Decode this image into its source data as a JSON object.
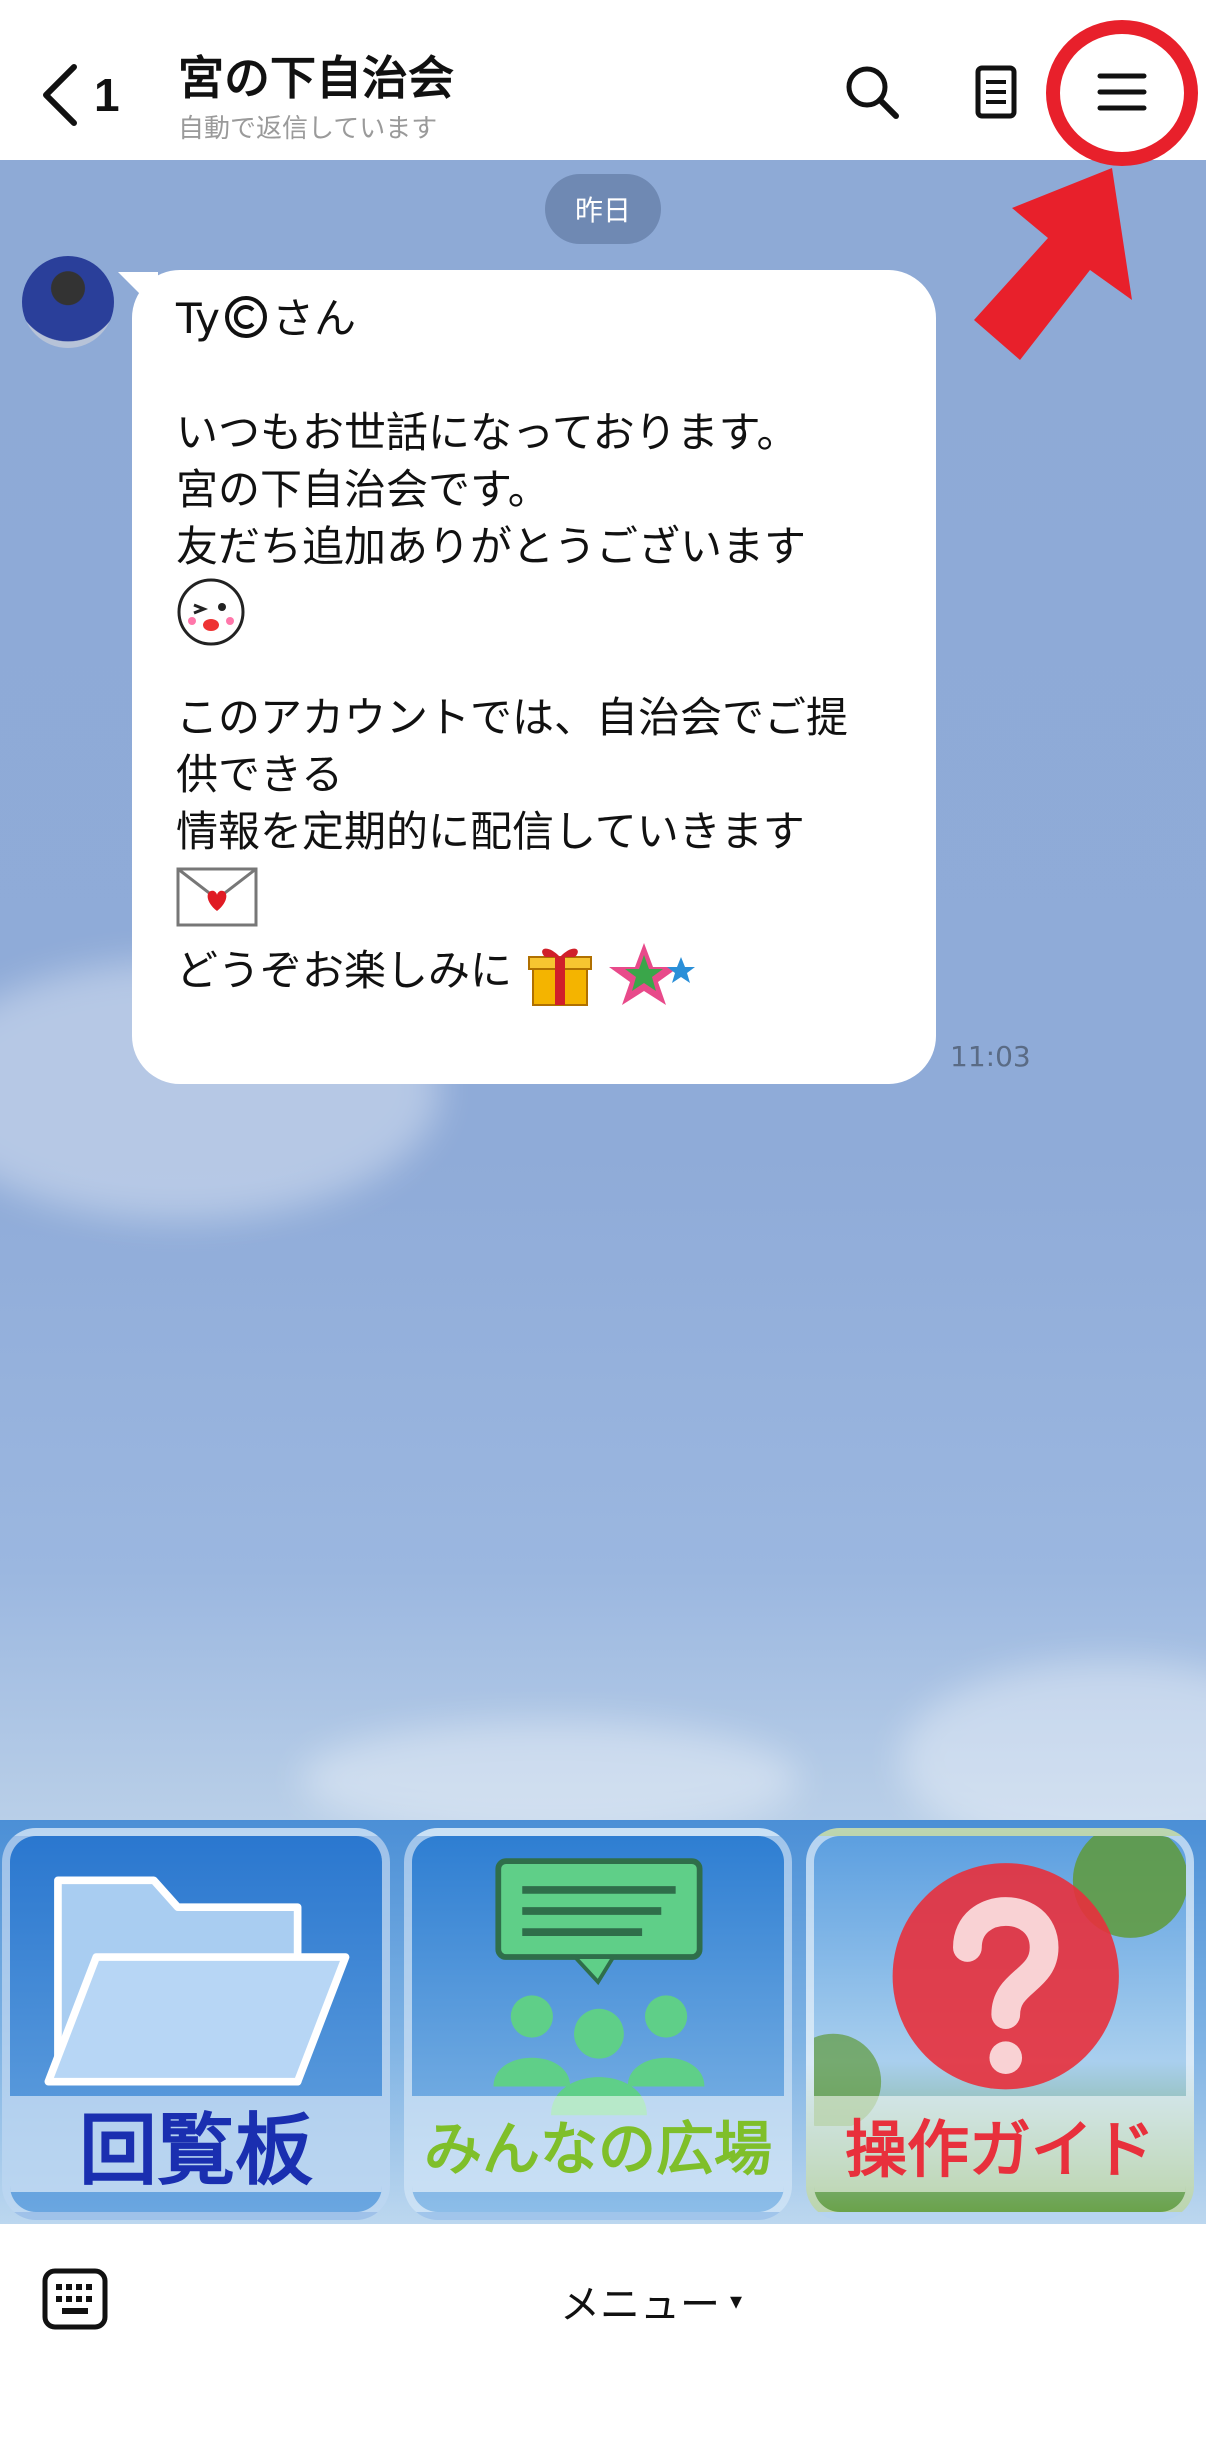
{
  "header": {
    "back_count": "1",
    "title": "宮の下自治会",
    "subtitle": "自動で返信しています",
    "icons": [
      "search-icon",
      "notes-icon",
      "menu-icon"
    ]
  },
  "chat": {
    "date_label": "昨日",
    "message": {
      "greeting_name": "Ty",
      "greeting_suffix": "さん",
      "line1": "いつもお世話になっております。",
      "line2": "宮の下自治会です。",
      "line3": "友だち追加ありがとうございます",
      "line4": "このアカウントでは、自治会でご提",
      "line5": "供できる",
      "line6": "情報を定期的に配信していきます",
      "line7": "どうぞお楽しみに",
      "time": "11:03"
    }
  },
  "rich_menu": {
    "items": [
      {
        "label": "回覧板",
        "icon": "folder-icon",
        "label_color": "#1a2fb0"
      },
      {
        "label": "みんなの広場",
        "icon": "community-icon",
        "label_color": "#7fbf2a"
      },
      {
        "label": "操作ガイド",
        "icon": "question-icon",
        "label_color": "#e8303c"
      }
    ]
  },
  "bottom_bar": {
    "menu_label": "メニュー",
    "caret": "▾"
  },
  "colors": {
    "chat_bg": "#8eaad6",
    "highlight_red": "#e8202b"
  }
}
